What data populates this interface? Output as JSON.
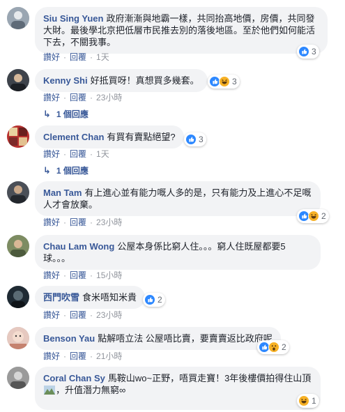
{
  "comments": [
    {
      "author": "Siu Sing Yuen",
      "text": "政府漸漸與地霸一樣，共同抬高地價，房價，共同發大財。最後學北京把低層市民推去別的落後地區。至於他們如何能活下去，不關我事。",
      "reactions": [
        "like"
      ],
      "count": "3",
      "like": "讚好",
      "reply": "回覆",
      "time": "1天",
      "avatar_color": "#8a9bb0"
    },
    {
      "author": "Kenny Shi",
      "text": "好抵買呀！真想買多幾套。",
      "reactions": [
        "like",
        "haha"
      ],
      "count": "3",
      "like": "讚好",
      "reply": "回覆",
      "time": "23小時",
      "replies": "1 個回應",
      "avatar_color": "#4a4f5a"
    },
    {
      "author": "Clement Chan",
      "text": "有買有賣點絕望?",
      "reactions": [
        "like"
      ],
      "count": "3",
      "like": "讚好",
      "reply": "回覆",
      "time": "1天",
      "replies": "1 個回應",
      "avatar_color": "#c0392b"
    },
    {
      "author": "Man Tam",
      "text": "有上進心並有能力嘅人多的是，只有能力及上進心不足嘅人才會放棄。",
      "reactions": [
        "like",
        "haha"
      ],
      "count": "2",
      "like": "讚好",
      "reply": "回覆",
      "time": "23小時",
      "avatar_color": "#3b4048"
    },
    {
      "author": "Chau Lam Wong",
      "text": "公屋本身係比窮人住。。。窮人住既屋都要5球。。。",
      "reactions": [],
      "count": "",
      "like": "讚好",
      "reply": "回覆",
      "time": "15小時",
      "avatar_color": "#6b7a5a"
    },
    {
      "author": "西門吹雪",
      "text": "食米唔知米貴",
      "reactions": [
        "like"
      ],
      "count": "2",
      "like": "讚好",
      "reply": "回覆",
      "time": "23小時",
      "avatar_color": "#1f2a33"
    },
    {
      "author": "Benson Yau",
      "text": "點解唔立法 公屋唔比賣，要賣賣返比政府呢",
      "reactions": [
        "like",
        "wow"
      ],
      "count": "2",
      "like": "讚好",
      "reply": "回覆",
      "time": "21小時",
      "avatar_color": "#d9a9a0"
    },
    {
      "author": "Coral Chan Sy",
      "text": "馬鞍山wo~正野，唔買走寶！3年後樓價拍得住山頂",
      "text2": "，升值潛力無窮∞",
      "reactions": [
        "haha"
      ],
      "count": "1",
      "like": "讚好",
      "reply": "回覆",
      "time": "1天",
      "avatar_color": "#8e8e8e"
    }
  ],
  "colors": {
    "like": "#2d88ff",
    "haha": "#f7b125",
    "wow": "#f7b125",
    "link": "#385898",
    "bubble": "#f2f3f5"
  }
}
